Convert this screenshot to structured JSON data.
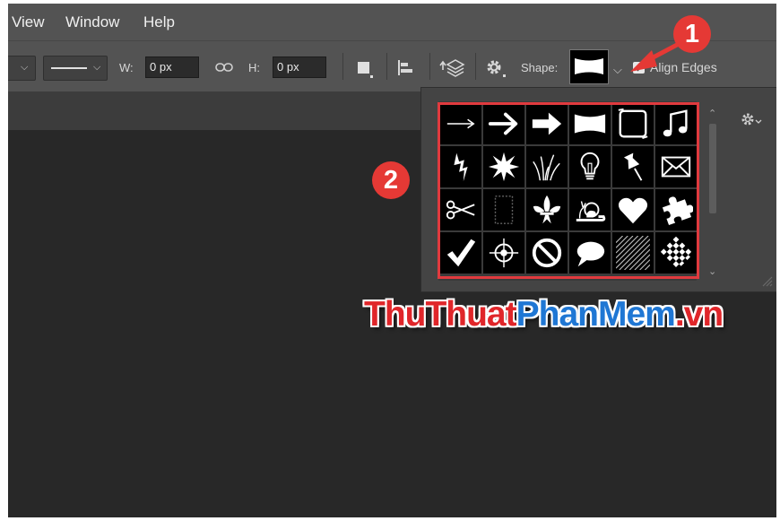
{
  "menu": {
    "items": [
      "View",
      "Window",
      "Help"
    ]
  },
  "options": {
    "w_label": "W:",
    "w_value": "0 px",
    "h_label": "H:",
    "h_value": "0 px",
    "shape_label": "Shape:",
    "align_label": "Align Edges",
    "align_checked": true
  },
  "shape_picker": {
    "shapes": [
      "arrow-thin",
      "arrow-bold",
      "arrow-block",
      "banner",
      "frame",
      "music-note",
      "lightning",
      "starburst",
      "grass",
      "lightbulb",
      "pushpin",
      "envelope",
      "scissors",
      "stamp-frame",
      "fleur-de-lis",
      "snail",
      "heart",
      "puzzle-piece",
      "checkmark",
      "target",
      "no-sign",
      "speech-bubble",
      "diagonal-lines",
      "checkerboard"
    ]
  },
  "annotations": {
    "badge_1": "1",
    "badge_2": "2"
  },
  "watermark": {
    "part1": "ThuThuat",
    "part2": "PhanMem",
    "part3": ".vn"
  },
  "colors": {
    "highlight": "#e03a3e",
    "badge": "#e53935",
    "watermark_red": "#e0262a",
    "watermark_blue": "#1f77d4"
  }
}
